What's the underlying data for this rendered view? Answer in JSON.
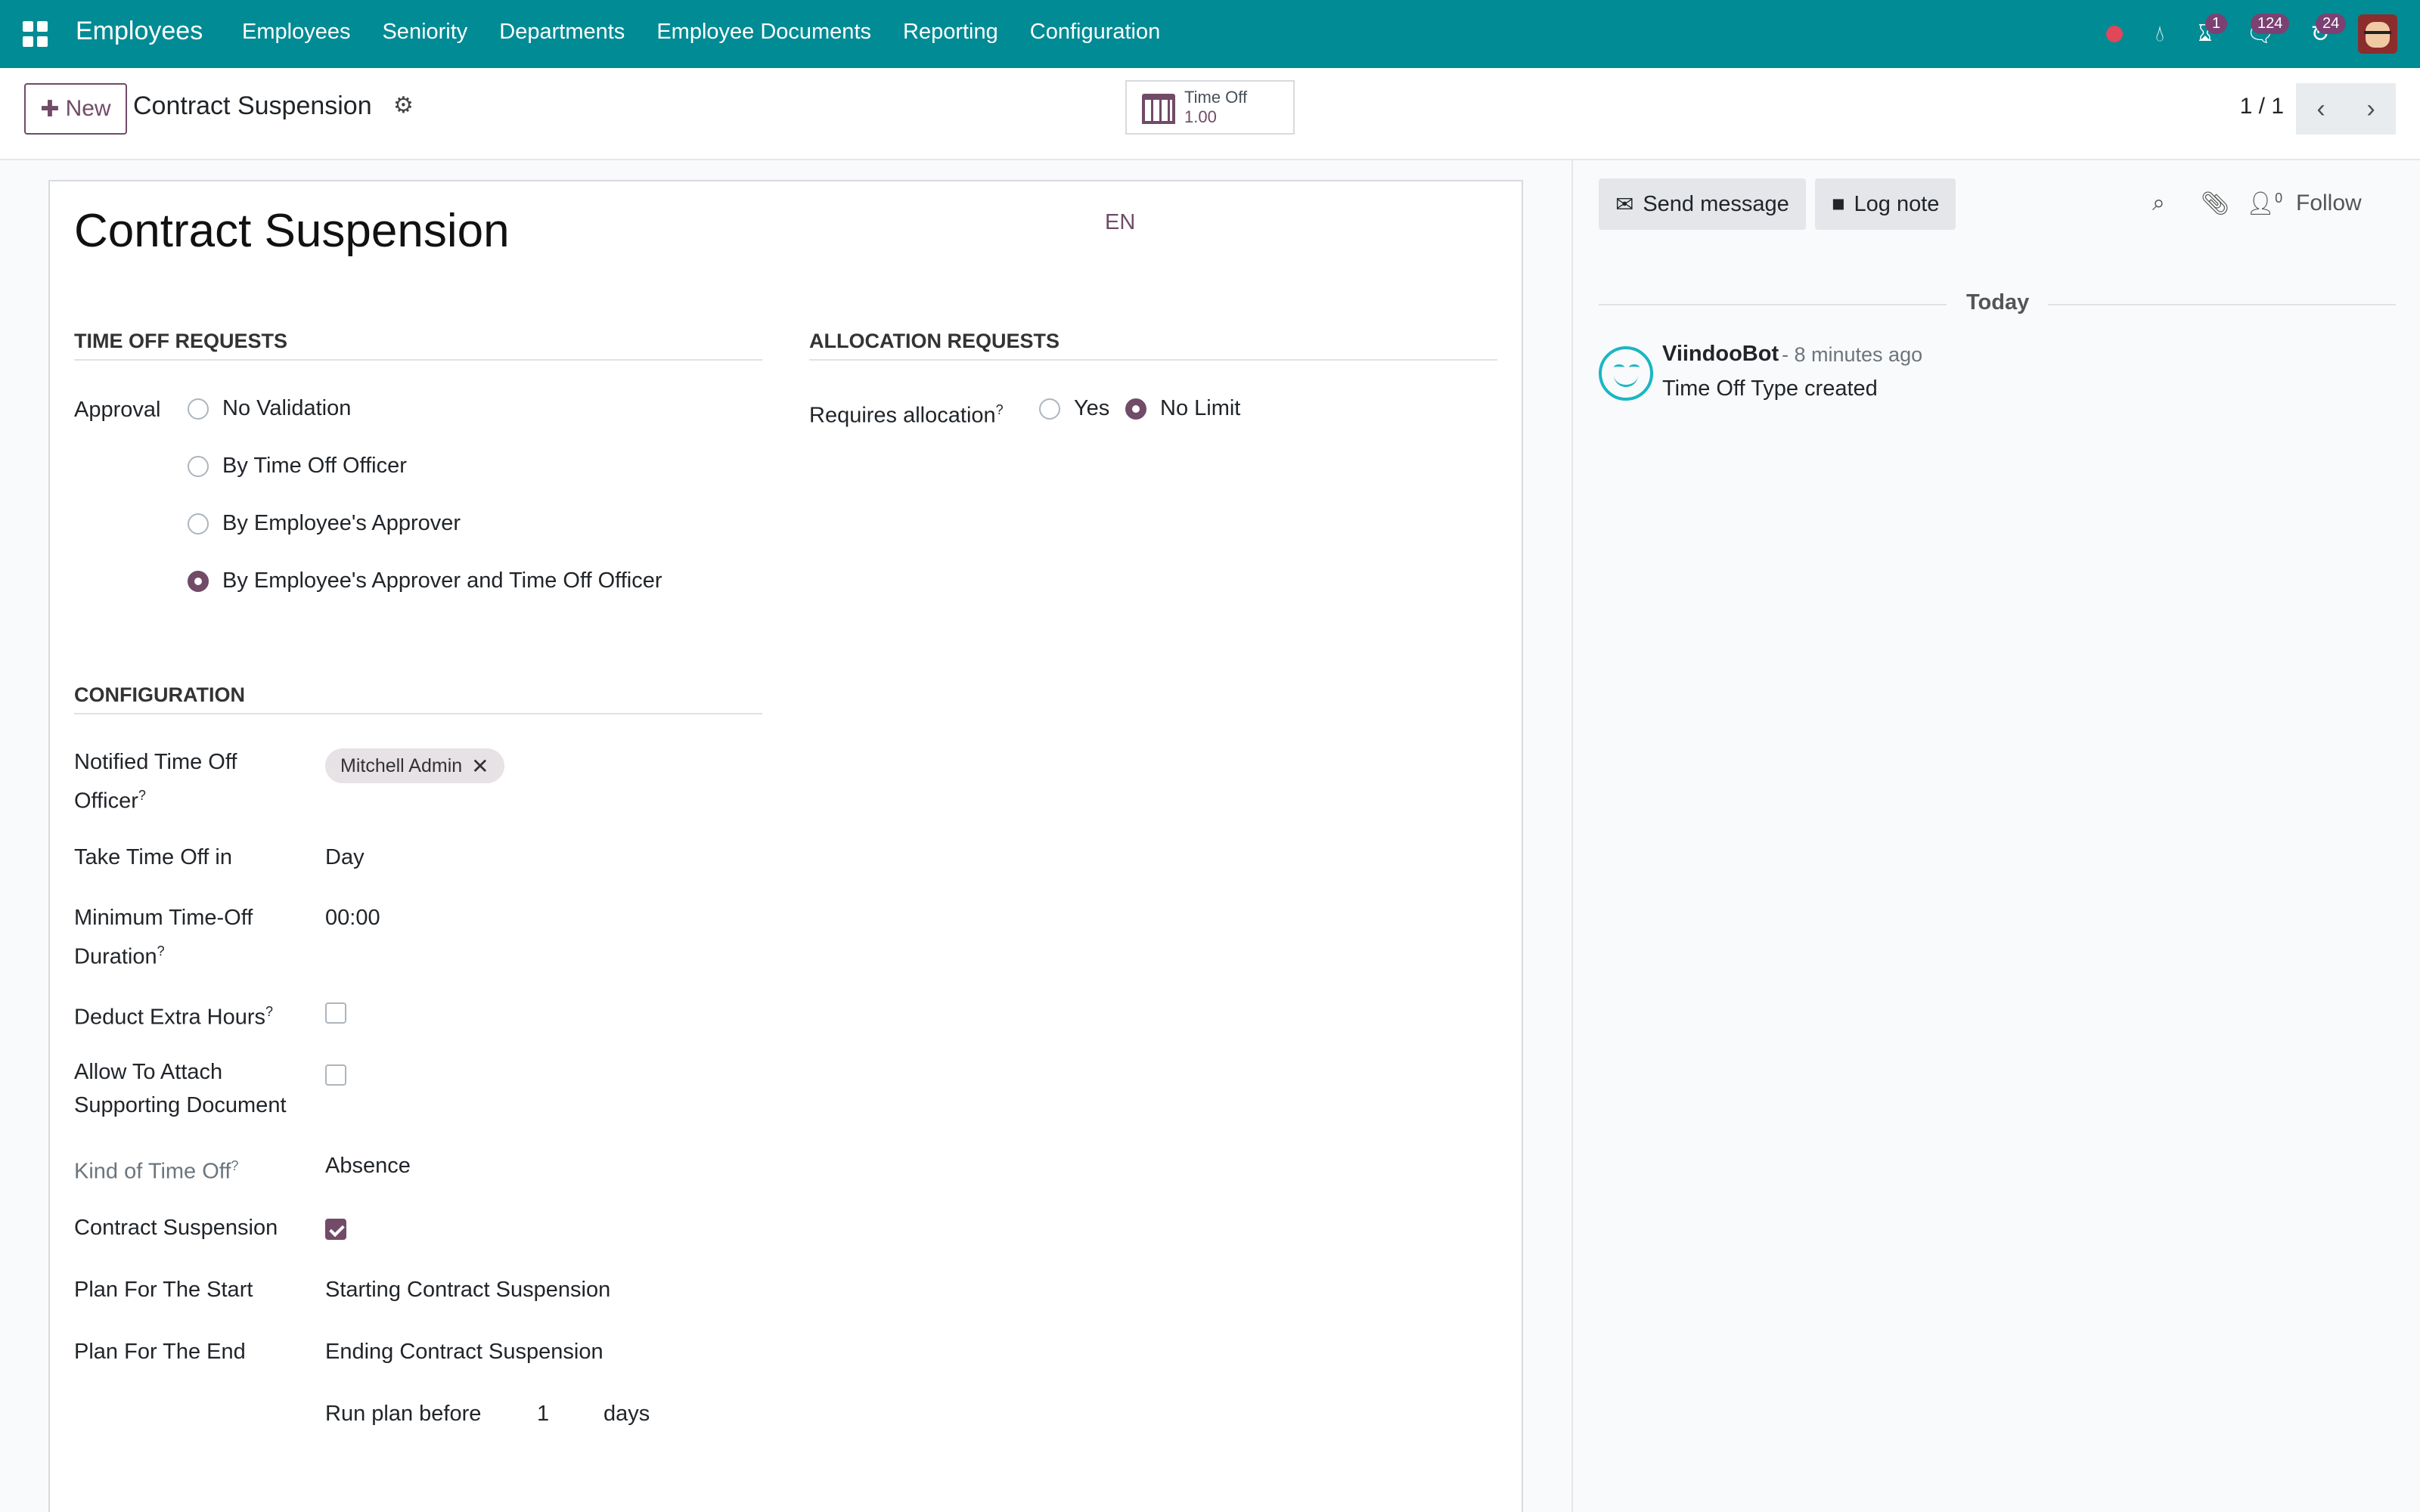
{
  "navbar": {
    "app_name": "Employees",
    "menu": [
      "Employees",
      "Seniority",
      "Departments",
      "Employee Documents",
      "Reporting",
      "Configuration"
    ],
    "badges": {
      "activity": "1",
      "messages": "124",
      "updates": "24"
    }
  },
  "control": {
    "new_label": "New",
    "breadcrumb": "Contract Suspension",
    "smart_button": {
      "label": "Time Off",
      "value": "1.00"
    },
    "pager": "1 / 1"
  },
  "form": {
    "title": "Contract Suspension",
    "lang": "EN",
    "time_off_requests": {
      "heading": "TIME OFF REQUESTS",
      "approval_label": "Approval",
      "options": [
        "No Validation",
        "By Time Off Officer",
        "By Employee's Approver",
        "By Employee's Approver and Time Off Officer"
      ],
      "selected": 3
    },
    "allocation_requests": {
      "heading": "ALLOCATION REQUESTS",
      "requires_label": "Requires allocation",
      "help": "?",
      "options": [
        "Yes",
        "No Limit"
      ],
      "selected": 1
    },
    "configuration": {
      "heading": "CONFIGURATION",
      "notified_label_1": "Notified Time Off",
      "notified_label_2": "Officer",
      "notified_tag": "Mitchell Admin",
      "take_label": "Take Time Off in",
      "take_value": "Day",
      "min_label_1": "Minimum Time-Off",
      "min_label_2": "Duration",
      "min_value": "00:00",
      "deduct_label": "Deduct Extra Hours",
      "deduct_checked": false,
      "attach_label_1": "Allow To Attach",
      "attach_label_2": "Supporting Document",
      "attach_checked": false,
      "kind_label": "Kind of Time Off",
      "kind_value": "Absence",
      "suspension_label": "Contract Suspension",
      "suspension_checked": true,
      "plan_start_label": "Plan For The Start",
      "plan_start_value": "Starting Contract Suspension",
      "plan_end_label": "Plan For The End",
      "plan_end_value": "Ending Contract Suspension",
      "run_before_label": "Run plan before",
      "run_before_value": "1",
      "run_before_unit": "days",
      "help": "?"
    }
  },
  "chatter": {
    "send_message": "Send message",
    "log_note": "Log note",
    "followers_count": "0",
    "follow": "Follow",
    "date_separator": "Today",
    "messages": [
      {
        "author": "ViindooBot",
        "time": "- 8 minutes ago",
        "body": "Time Off Type created"
      }
    ]
  },
  "colors": {
    "navbar": "#018b94",
    "primary": "#714b67",
    "bot": "#1ab6c4"
  }
}
